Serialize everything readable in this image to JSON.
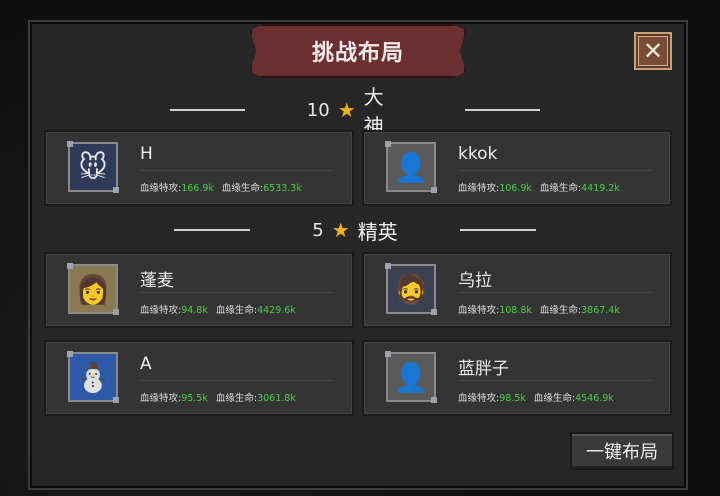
{
  "dialog": {
    "title": "挑战布局",
    "close_icon": "close-icon",
    "deploy_button": "一键布局"
  },
  "sections": [
    {
      "rank": "10",
      "label": "大神"
    },
    {
      "rank": "5",
      "label": "精英"
    }
  ],
  "stat_labels": {
    "attack": "血缘特攻:",
    "life": "血缘生命:"
  },
  "cards": [
    {
      "name": "H",
      "attack": "166.9k",
      "life": "6533.3k",
      "avatar": "gray-mouse-avatar"
    },
    {
      "name": "kkok",
      "attack": "106.9k",
      "life": "4419.2k",
      "avatar": "white-hair-swordsman-avatar"
    },
    {
      "name": "蓬麦",
      "attack": "94.8k",
      "life": "4429.6k",
      "avatar": "blonde-lady-avatar"
    },
    {
      "name": "乌拉",
      "attack": "108.8k",
      "life": "3867.4k",
      "avatar": "eyepatch-man-avatar"
    },
    {
      "name": "A",
      "attack": "95.5k",
      "life": "3061.8k",
      "avatar": "snowman-avatar"
    },
    {
      "name": "蓝胖子",
      "attack": "98.5k",
      "life": "4546.9k",
      "avatar": "white-hair-swordsman-avatar"
    }
  ],
  "colors": {
    "stat_value": "#47d147",
    "star": "#f2b21a",
    "banner": "#6b2f2f"
  }
}
